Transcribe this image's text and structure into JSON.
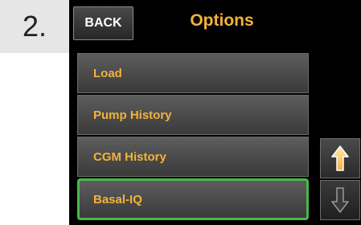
{
  "step": {
    "number": "2."
  },
  "header": {
    "back_label": "BACK",
    "title": "Options"
  },
  "menu": {
    "items": [
      {
        "label": "Load"
      },
      {
        "label": "Pump History"
      },
      {
        "label": "CGM History"
      },
      {
        "label": "Basal-IQ",
        "selected": true
      }
    ]
  },
  "scroll": {
    "up_icon": "arrow-up-icon",
    "down_icon": "arrow-down-icon"
  },
  "colors": {
    "accent": "#f3b23a",
    "selection": "#49b84b",
    "screen_bg": "#000000"
  }
}
